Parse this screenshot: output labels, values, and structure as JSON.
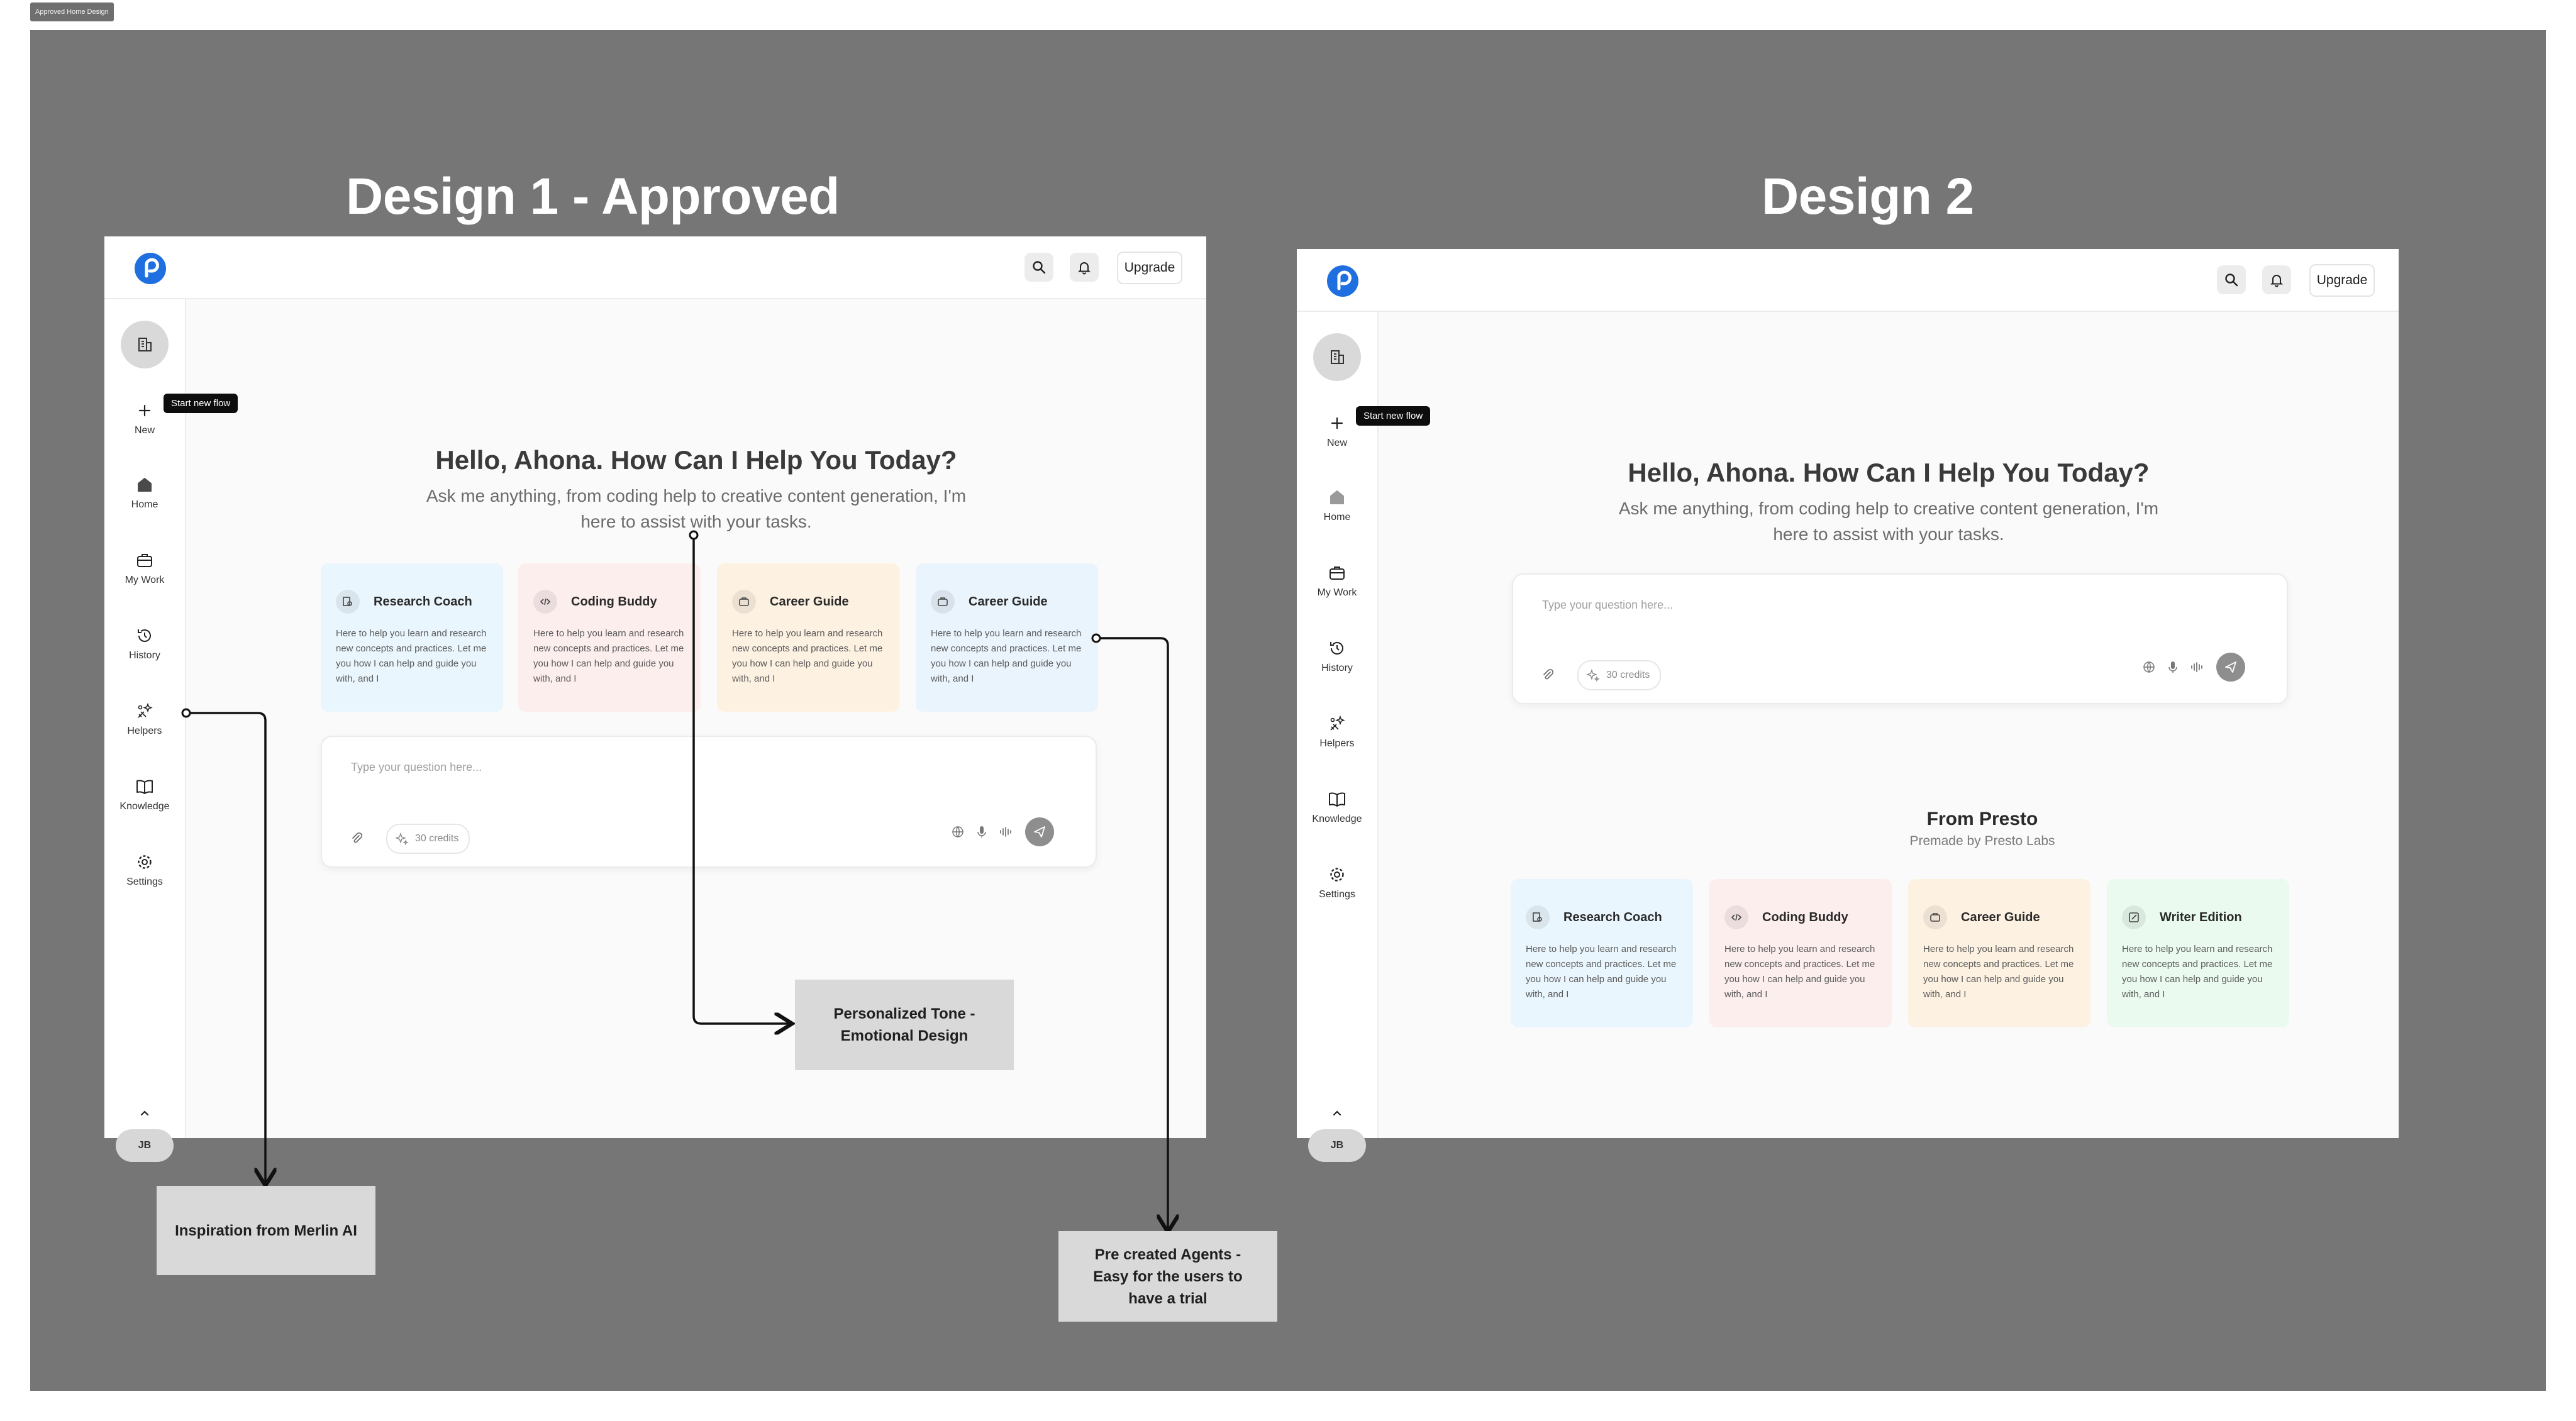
{
  "frame_label": "Approved Home Design",
  "colors": {
    "canvas": "#767676",
    "brand_blue": "#1f6fe0",
    "card_research": "#eaf6fd",
    "card_coding": "#fdeeee",
    "card_career": "#fdf1e1",
    "card_career_alt": "#eaf4fd",
    "card_writer": "#eafaee",
    "note_bg": "#d9d9d9"
  },
  "design1": {
    "title": "Design 1 - Approved",
    "topbar": {
      "upgrade_label": "Upgrade",
      "search_icon": "search-icon",
      "bell_icon": "bell-icon"
    },
    "tooltip": "Start new flow",
    "nav": [
      {
        "label": "New",
        "icon": "plus-icon"
      },
      {
        "label": "Home",
        "icon": "home-icon"
      },
      {
        "label": "My Work",
        "icon": "briefcase-icon"
      },
      {
        "label": "History",
        "icon": "history-icon"
      },
      {
        "label": "Helpers",
        "icon": "sparkle-icon"
      },
      {
        "label": "Knowledge",
        "icon": "book-icon"
      },
      {
        "label": "Settings",
        "icon": "gear-icon"
      }
    ],
    "avatar": "JB",
    "greeting": "Hello, Ahona. How Can I Help You Today?",
    "subtext_line1": "Ask me anything, from coding help to creative content generation, I'm",
    "subtext_line2": "here to assist with your tasks.",
    "cards": [
      {
        "title": "Research Coach",
        "desc": "Here to help you learn and research new concepts and practices. Let me you how I can help and guide you with, and I",
        "icon": "research-icon"
      },
      {
        "title": "Coding Buddy",
        "desc": "Here to help you learn and research new concepts and practices. Let me you how I can help and guide you with, and I",
        "icon": "code-icon"
      },
      {
        "title": "Career Guide",
        "desc": "Here to help you learn and research new concepts and practices. Let me you how I can help and guide you with, and I",
        "icon": "career-icon"
      },
      {
        "title": "Career Guide",
        "desc": "Here to help you learn and research new concepts and practices. Let me you how I can help and guide you with, and I",
        "icon": "career-icon"
      }
    ],
    "chat": {
      "placeholder": "Type your question here...",
      "credits": "30 credits"
    }
  },
  "design2": {
    "title": "Design 2",
    "topbar": {
      "upgrade_label": "Upgrade"
    },
    "tooltip": "Start new flow",
    "nav": [
      {
        "label": "New",
        "icon": "plus-icon"
      },
      {
        "label": "Home",
        "icon": "home-icon"
      },
      {
        "label": "My Work",
        "icon": "briefcase-icon"
      },
      {
        "label": "History",
        "icon": "history-icon"
      },
      {
        "label": "Helpers",
        "icon": "sparkle-icon"
      },
      {
        "label": "Knowledge",
        "icon": "book-icon"
      },
      {
        "label": "Settings",
        "icon": "gear-icon"
      }
    ],
    "avatar": "JB",
    "greeting": "Hello, Ahona. How Can I Help You Today?",
    "subtext_line1": "Ask me anything, from coding help to creative content generation, I'm",
    "subtext_line2": "here to assist with your tasks.",
    "chat": {
      "placeholder": "Type your question here...",
      "credits": "30 credits"
    },
    "section_title": "From Presto",
    "section_subtitle": "Premade by Presto Labs",
    "cards": [
      {
        "title": "Research Coach",
        "desc": "Here to help you learn and research new concepts and practices. Let me you how I can help and guide you with, and I",
        "icon": "research-icon"
      },
      {
        "title": "Coding Buddy",
        "desc": "Here to help you learn and research new concepts and practices. Let me you how I can help and guide you with, and I",
        "icon": "code-icon"
      },
      {
        "title": "Career Guide",
        "desc": "Here to help you learn and research new concepts and practices. Let me you how I can help and guide you with, and I",
        "icon": "career-icon"
      },
      {
        "title": "Writer Edition",
        "desc": "Here to help you learn and research new concepts and practices. Let me you how I can help and guide you with, and I",
        "icon": "pencil-icon"
      }
    ]
  },
  "annotations": {
    "personalized": "Personalized Tone - Emotional Design",
    "merlin": "Inspiration from Merlin AI",
    "agents": "Pre created Agents - Easy for the users to have a trial"
  }
}
